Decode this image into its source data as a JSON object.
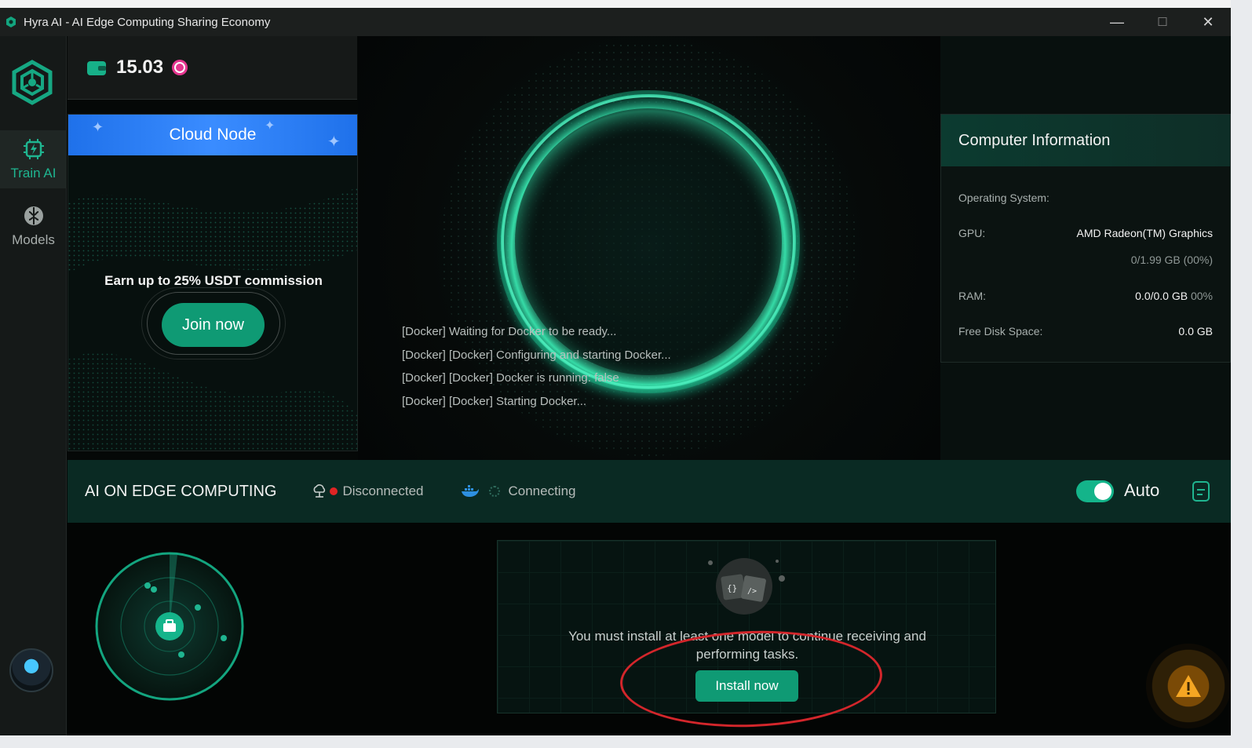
{
  "window": {
    "title": "Hyra AI - AI Edge Computing Sharing Economy",
    "controls": {
      "minimize": "—",
      "maximize": "☐",
      "close": "✕"
    }
  },
  "sidebar": {
    "items": [
      {
        "label": "Train AI",
        "icon": "chip-bolt-icon",
        "active": true
      },
      {
        "label": "Models",
        "icon": "brain-icon",
        "active": false
      }
    ]
  },
  "balance": {
    "amount": "15.03",
    "wallet_icon": "wallet-icon",
    "coin_icon": "hyra-coin-icon"
  },
  "promo": {
    "title": "Cloud Node",
    "text": "Earn up to 25% USDT commission",
    "button": "Join now"
  },
  "logs": [
    "[Docker] Waiting for Docker to be ready...",
    "[Docker] [Docker] Configuring and starting Docker...",
    "[Docker] [Docker] Docker is running: false",
    "[Docker] [Docker] Starting Docker..."
  ],
  "computer_info": {
    "title": "Computer Information",
    "os_label": "Operating System:",
    "os_value": "",
    "gpu_label": "GPU:",
    "gpu_value": "AMD Radeon(TM) Graphics",
    "gpu_mem": "0/1.99 GB (00%)",
    "ram_label": "RAM:",
    "ram_value": "0.0/0.0 GB",
    "ram_pct": "00%",
    "disk_label": "Free Disk Space:",
    "disk_value": "0.0 GB"
  },
  "status": {
    "title": "AI ON EDGE COMPUTING",
    "network": "Disconnected",
    "docker": "Connecting",
    "auto_label": "Auto",
    "auto_enabled": true
  },
  "install": {
    "message_line1": "You must install at least one model to continue receiving and",
    "message_line2": "performing tasks.",
    "button": "Install now"
  },
  "colors": {
    "accent": "#0f9a74",
    "promo_blue": "#2b7ff5",
    "status_red": "#e02424",
    "warning": "#f5a623"
  }
}
